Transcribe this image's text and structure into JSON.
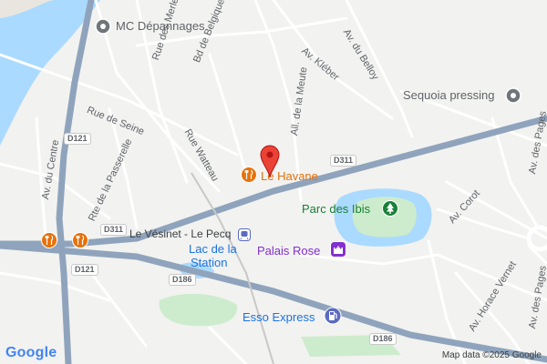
{
  "map": {
    "pois": {
      "mc_depannages": "MC Dépannages",
      "sequoia": "Sequoia pressing",
      "le_havane": "Le Havane",
      "parc_des_ibis": "Parc des Ibis",
      "palais_rose": "Palais Rose",
      "esso": "Esso Express",
      "lac_line1": "Lac de la",
      "lac_line2": "Station"
    },
    "transit": {
      "station": "Le Vésinet - Le Pecq"
    },
    "streets": {
      "rue_merlettes": "Rue des Merlettes",
      "bd_belgique": "Bd de Belgique",
      "rue_watteau": "Rue Watteau",
      "rue_de_seine": "Rue de Seine",
      "av_du_centre": "Av. du Centre",
      "rte_passerelle": "Rte de la Passerelle",
      "all_meute": "All. de la Meute",
      "av_kleber": "Av. Kléber",
      "av_belloy": "Av. du Belloy",
      "av_des_pages_1": "Av. des Pages",
      "av_des_pages_2": "Av. des Pages",
      "av_corot": "Av. Corot",
      "av_horace_vernet": "Av. Horace Vernet"
    },
    "road_shields": {
      "d311_a": "D311",
      "d311_b": "D311",
      "d121_a": "D121",
      "d121_b": "D121",
      "d186_a": "D186",
      "d186_b": "D186"
    },
    "colors": {
      "water": "#aadaff",
      "park": "#cdeccd",
      "highway": "#8fa4bc",
      "road": "#ffffff",
      "poi_orange": "#e8710a",
      "poi_green": "#188038",
      "poi_purple": "#8430ce",
      "poi_gray": "#70757a",
      "poi_blue": "#1a73e8",
      "pin_red": "#ea4335"
    },
    "icons": {
      "poi_gray": "map-pin-icon",
      "restaurant": "restaurant-icon",
      "park": "park-tree-icon",
      "palace": "castle-icon",
      "gas": "gas-station-icon",
      "train": "train-icon",
      "pin": "red-map-pin-icon"
    },
    "google_logo": "Google",
    "attribution": "Map data ©2025 Google"
  }
}
